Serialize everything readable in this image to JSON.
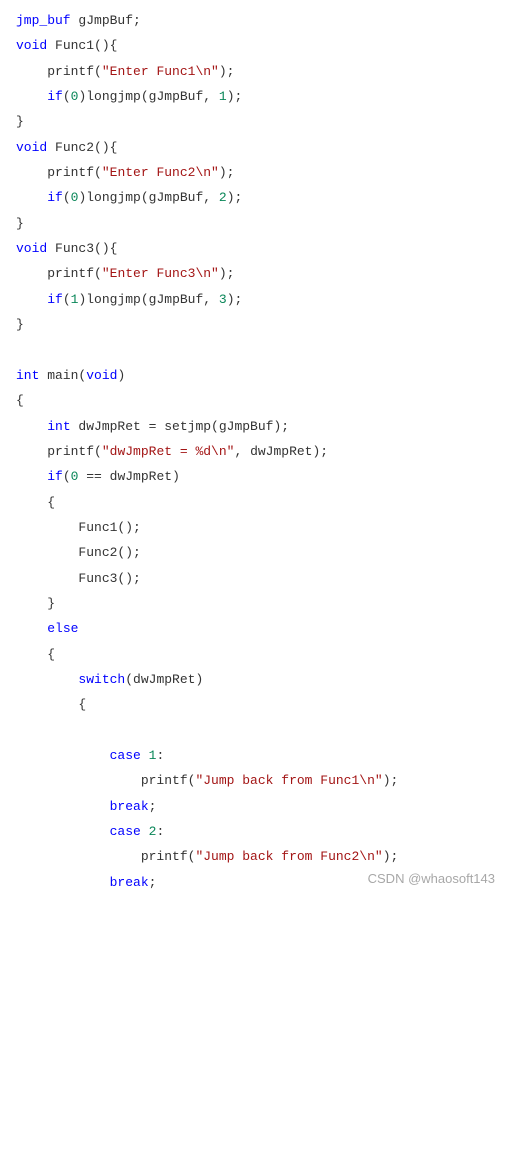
{
  "code": {
    "l01_decl_type": "jmp_buf",
    "l01_decl_name": " gJmpBuf;",
    "l02_void": "void",
    "l02_name": " Func1(){",
    "l03_pf": "printf",
    "l03_open": "(",
    "l03_str": "\"Enter Func1\\n\"",
    "l03_close": ");",
    "l04_if": "if",
    "l04_open": "(",
    "l04_num": "0",
    "l04_rest": ")longjmp(gJmpBuf, ",
    "l04_num2": "1",
    "l04_end": ");",
    "l05_brace": "}",
    "l06_void": "void",
    "l06_name": " Func2(){",
    "l07_pf": "printf",
    "l07_open": "(",
    "l07_str": "\"Enter Func2\\n\"",
    "l07_close": ");",
    "l08_if": "if",
    "l08_open": "(",
    "l08_num": "0",
    "l08_rest": ")longjmp(gJmpBuf, ",
    "l08_num2": "2",
    "l08_end": ");",
    "l09_brace": "}",
    "l10_void": "void",
    "l10_name": " Func3(){",
    "l11_pf": "printf",
    "l11_open": "(",
    "l11_str": "\"Enter Func3\\n\"",
    "l11_close": ");",
    "l12_if": "if",
    "l12_open": "(",
    "l12_num": "1",
    "l12_rest": ")longjmp(gJmpBuf, ",
    "l12_num2": "3",
    "l12_end": ");",
    "l13_brace": "}",
    "l14_int": "int",
    "l14_main": " main(",
    "l14_void": "void",
    "l14_close": ")",
    "l15_brace": "{",
    "l16_int": "int",
    "l16_rest": " dwJmpRet = setjmp(gJmpBuf);",
    "l17_pf": "printf",
    "l17_open": "(",
    "l17_str": "\"dwJmpRet = %d\\n\"",
    "l17_close": ", dwJmpRet);",
    "l18_if": "if",
    "l18_open": "(",
    "l18_num": "0",
    "l18_rest": " == dwJmpRet)",
    "l19_brace": "{",
    "l20": "Func1();",
    "l21": "Func2();",
    "l22": "Func3();",
    "l23_brace": "}",
    "l24_else": "else",
    "l25_brace": "{",
    "l26_switch": "switch",
    "l26_rest": "(dwJmpRet)",
    "l27_brace": "{",
    "l28_case": "case",
    "l28_sp": " ",
    "l28_num": "1",
    "l28_colon": ":",
    "l29_pf": "printf",
    "l29_open": "(",
    "l29_str": "\"Jump back from Func1\\n\"",
    "l29_close": ");",
    "l30_break": "break",
    "l30_semi": ";",
    "l31_case": "case",
    "l31_sp": " ",
    "l31_num": "2",
    "l31_colon": ":",
    "l32_pf": "printf",
    "l32_open": "(",
    "l32_str": "\"Jump back from Func2\\n\"",
    "l32_close": ");",
    "l33_break": "break",
    "l33_semi": ";"
  },
  "watermark": "CSDN @whaosoft143"
}
